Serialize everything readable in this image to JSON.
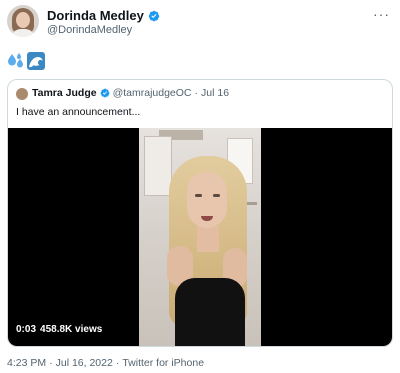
{
  "author": {
    "display_name": "Dorinda Medley",
    "handle": "@DorindaMedley",
    "verified": true
  },
  "menu_icon": "more-horizontal-icon",
  "tweet_emojis": [
    "sweat-droplets-emoji",
    "water-wave-emoji"
  ],
  "quoted": {
    "display_name": "Tamra Judge",
    "handle": "@tamrajudgeOC",
    "separator": "·",
    "date": "Jul 16",
    "text": "I have an announcement...",
    "video": {
      "time": "0:03",
      "views": "458.8K views"
    }
  },
  "footer": {
    "time": "4:23 PM",
    "sep1": "·",
    "date": "Jul 16, 2022",
    "sep2": "·",
    "source": "Twitter for iPhone"
  },
  "colors": {
    "verified_blue": "#1d9bf0",
    "secondary_text": "#536471",
    "border": "#cfd9de"
  }
}
